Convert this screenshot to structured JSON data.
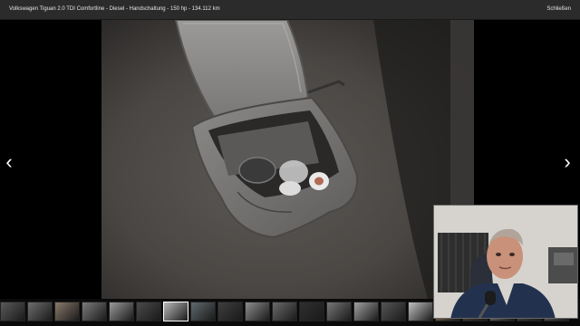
{
  "header": {
    "title": "Volkswagen Tiguan 2.0 TDI Comfortline - Diesel - Handschaltung - 150 hp - 134.112 km",
    "close_label": "Schließen"
  },
  "nav": {
    "prev_glyph": "‹",
    "next_glyph": "›"
  },
  "thumbnails": {
    "active_index": 6,
    "tones": [
      "#5a5a5a",
      "#6e6e6e",
      "#8a7a6a",
      "#7c7c7c",
      "#9a9a9a",
      "#4a4a4a",
      "#b8b8b8",
      "#5f6a6f",
      "#3e3e3e",
      "#8d8d8d",
      "#6a6a6a",
      "#2f2f2f",
      "#777777",
      "#a0a0a0",
      "#555555",
      "#c0c0c0",
      "#9c7a5a",
      "#5a4a3a",
      "#808080",
      "#4c4c4c",
      "#6c6c6c"
    ]
  },
  "colors": {
    "topbar": "#2b2b2b",
    "thumb_active_border": "#ffffff"
  }
}
